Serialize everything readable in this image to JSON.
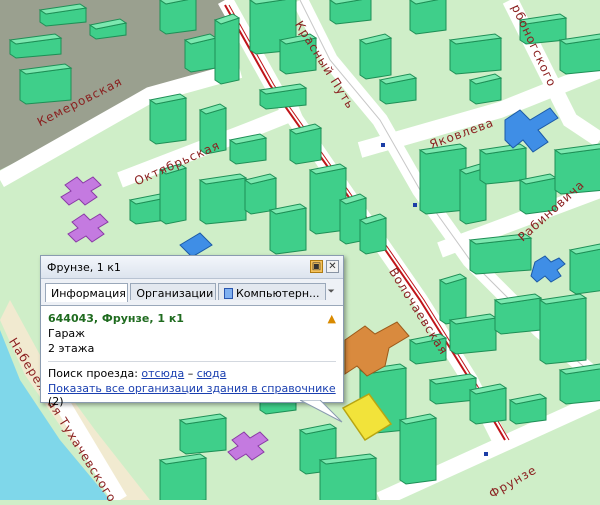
{
  "map": {
    "streets": [
      {
        "id": "kemerovskaya",
        "label": "Кемеровская"
      },
      {
        "id": "oktyabrskaya",
        "label": "Октябрьская"
      },
      {
        "id": "krasny-put",
        "label": "Красный Путь"
      },
      {
        "id": "yakovleva",
        "label": "Яковлева"
      },
      {
        "id": "rabinovicha",
        "label": "Рабиновича"
      },
      {
        "id": "krasnoflotskogo",
        "label": "рбоногского"
      },
      {
        "id": "volochaevskaya",
        "label": "Волочаевская"
      },
      {
        "id": "tukhachevskogo",
        "label": "Набережная Тухачевского"
      },
      {
        "id": "frunze",
        "label": "Фрунзе"
      }
    ],
    "colors": {
      "background": "#cfeec8",
      "building": "#3fcf8a",
      "highlight": "#f2e33a",
      "river": "#7fd7ea",
      "industrial": "#9aa08f",
      "tram": "#c0151a"
    }
  },
  "popup": {
    "title": "Фрунзе, 1 к1",
    "tabs": [
      {
        "label": "Информация",
        "active": true
      },
      {
        "label": "Организации",
        "active": false
      },
      {
        "label": "Компьютерн...",
        "active": false
      }
    ],
    "address": "644043, Фрунзе, 1 к1",
    "type": "Гараж",
    "floors": "2 этажа",
    "route_label": "Поиск проезда:",
    "route_from": "отсюда",
    "route_dash": "–",
    "route_to": "сюда",
    "show_orgs": "Показать все организации здания в справочнике",
    "org_count": "(2)"
  }
}
